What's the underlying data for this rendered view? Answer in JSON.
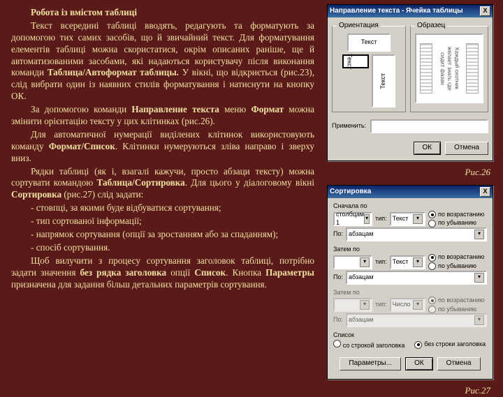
{
  "text": {
    "title": "Робота із вмістом таблиці",
    "p1a": "Текст всередині таблиці вводять, редагують та форматують за допомогою тих самих засобів, що й звичайний текст. Для форматування елементів таблиці можна скористатися, окрім описаних раніше, ще й автоматизованими засобами, які надаються користувачу після виконання команди ",
    "p1b": "Таблица/Автоформат таблицы.",
    "p1c": " У вікні, що відкриється (рис.23), слід вибрати один із наявних стилів форматування і натиснути на кнопку ОК.",
    "p2a": "За допомогою команди ",
    "p2b": "Направление текста",
    "p2c": " меню ",
    "p2d": "Формат",
    "p2e": " можна змінити орієнтацію тексту у цих клітинках (рис.26).",
    "p3a": "Для автоматичної нумерації виділених клітинок використовують команду ",
    "p3b": "Формат/Список",
    "p3c": ". Клітинки нумеруються зліва направо і зверху вниз.",
    "p4a": "Рядки таблиці (як і, взагалі кажучи, просто абзаци тексту) можна сортувати командою ",
    "p4b": "Таблица/Сортировка",
    "p4c": ". Для цього у діалоговому вікні ",
    "p4d": "Сортировка",
    "p4e": " (рис.27) слід задати:",
    "li1": "- стовпці, за якими буде відбуватися сортування;",
    "li2": "- тип сортованої інформації;",
    "li3": "- напрямок сортування (опції за зростанням або за спаданням);",
    "li4": "- спосіб сортування.",
    "p5a": "Щоб вилучити з процесу сортування заголовок таблиці, потрібно задати значення ",
    "p5b": "без рядка заголовка",
    "p5c": " опції ",
    "p5d": "Список",
    "p5e": ". Кнопка ",
    "p5f": "Параметры",
    "p5g": " призначена для задання більш детальних параметрів сортування."
  },
  "fig1": {
    "caption": "Рис.26",
    "title": "Направление текста - Ячейка таблицы",
    "grp_orient": "Ориентация",
    "grp_preview": "Образец",
    "sample": "Текст",
    "apply_lbl": "Применить:",
    "ok": "ОК",
    "cancel": "Отмена",
    "close": "X",
    "preview_text": "Каждый охотник желает знать где сидит фазан"
  },
  "fig2": {
    "caption": "Рис.27",
    "title": "Сортировка",
    "close": "X",
    "sort_first": "Сначала по",
    "type_lbl": "тип:",
    "by_lbl": "По:",
    "then_by": "Затем по",
    "val_col": "столбцам 1",
    "val_type_text": "Текст",
    "val_type_num": "Число",
    "val_by": "абзацам",
    "r_asc": "по возрастанию",
    "r_desc": "по убыванию",
    "list_lbl": "Список",
    "r_header": "со строкой заголовка",
    "r_noheader": "без строки заголовка",
    "btn_params": "Параметры...",
    "btn_ok": "ОК",
    "btn_cancel": "Отмена"
  }
}
